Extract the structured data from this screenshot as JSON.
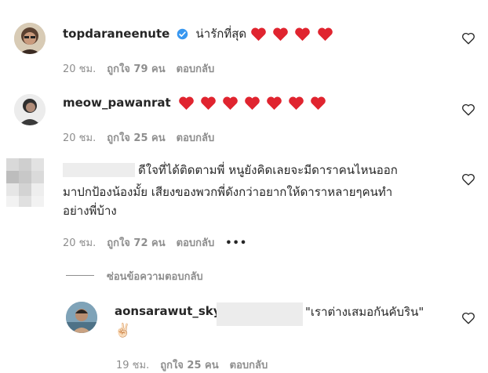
{
  "comments": [
    {
      "username": "topdaraneenute",
      "verified": true,
      "text": "น่ารักที่สุด",
      "hearts": 4,
      "time": "20 ชม.",
      "likes": "ถูกใจ 79 คน",
      "reply": "ตอบกลับ"
    },
    {
      "username": "meow_pawanrat",
      "text": "",
      "hearts": 7,
      "time": "20 ชม.",
      "likes": "ถูกใจ 25 คน",
      "reply": "ตอบกลับ"
    },
    {
      "username": "",
      "text_line1": "ดีใจที่ได้ติดตามพี่ หนูยังคิดเลยจะมีดาราคนไหนออก",
      "text_line2": "มาปกป้องน้องมั้ย เสียงของพวกพี่ดังกว่าอยากให้ดาราหลายๆคนทำ",
      "text_line3": "อย่างพี่บ้าง",
      "time": "20 ชม.",
      "likes": "ถูกใจ 72 คน",
      "reply": "ตอบกลับ",
      "more": "•••"
    }
  ],
  "hide_replies": "ซ่อนข้อความตอบกลับ",
  "reply_comment": {
    "username": "aonsarawut_sky",
    "quote": "\"เราต่างเสมอกันคับริน\"",
    "emoji": "✌🏻",
    "time": "19 ชม.",
    "likes": "ถูกใจ 25 คน",
    "reply": "ตอบกลับ"
  },
  "colors": {
    "text": "#262626",
    "meta": "#8e8e8e",
    "heart": "#ed4956",
    "verified": "#3897f0"
  }
}
